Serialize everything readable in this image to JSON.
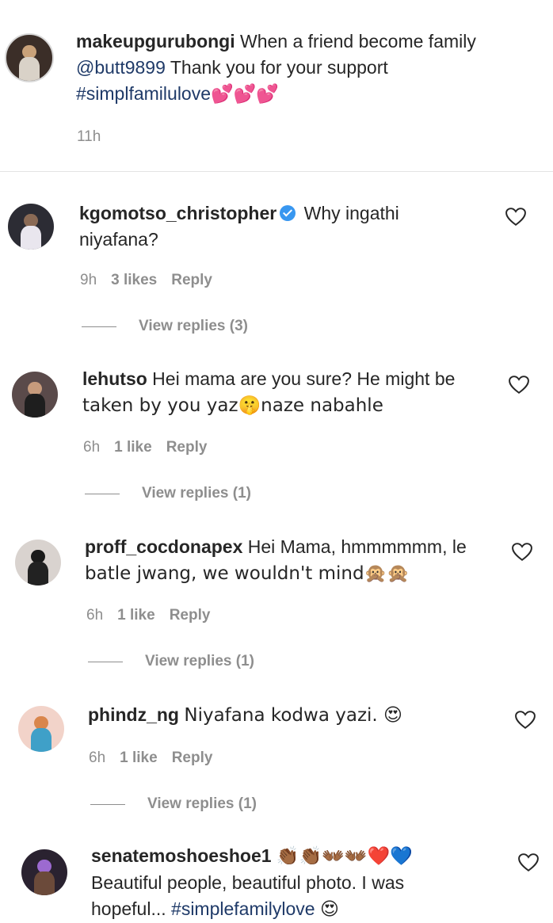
{
  "post": {
    "username": "makeupgurubongi",
    "text_line1": "When a friend become family",
    "mention": "@butt9899",
    "text_line2": "Thank you for your support",
    "hashtag": "#simplfamilulove",
    "emojis": "💕💕💕",
    "time": "11h"
  },
  "comments": [
    {
      "username": "kgomotso_christopher",
      "verified": true,
      "line1": "Why ingathi",
      "line2": "niyafana?",
      "time": "9h",
      "likes": "3 likes",
      "reply": "Reply",
      "view_replies": "View replies (3)"
    },
    {
      "username": "lehutso",
      "line1": "Hei mama are you sure? He might be",
      "line2": "taken by you yaz🤫naze nabahle",
      "time": "6h",
      "likes": "1 like",
      "reply": "Reply",
      "view_replies": "View replies (1)"
    },
    {
      "username": "proff_cocdonapex",
      "line1": "Hei Mama, hmmmmmm, le",
      "line2": "batle jwang, we wouldn't mind🙊🙊",
      "time": "6h",
      "likes": "1 like",
      "reply": "Reply",
      "view_replies": "View replies (1)"
    },
    {
      "username": "phindz_ng",
      "line1": "Niyafana kodwa yazi. 😍",
      "time": "6h",
      "likes": "1 like",
      "reply": "Reply",
      "view_replies": "View replies (1)"
    },
    {
      "username": "senatemoshoeshoe1",
      "line1": "👏🏾👏🏾👐🏾👐🏾❤️💙",
      "line2": "Beautiful people, beautiful photo. I was",
      "line3_text": "hopeful...",
      "line3_hashtag": "#simplefamilylove",
      "line3_emoji": "😍"
    }
  ],
  "colors": {
    "link": "#1f3a68",
    "meta": "#8e8e8e",
    "verified": "#3897f0"
  }
}
